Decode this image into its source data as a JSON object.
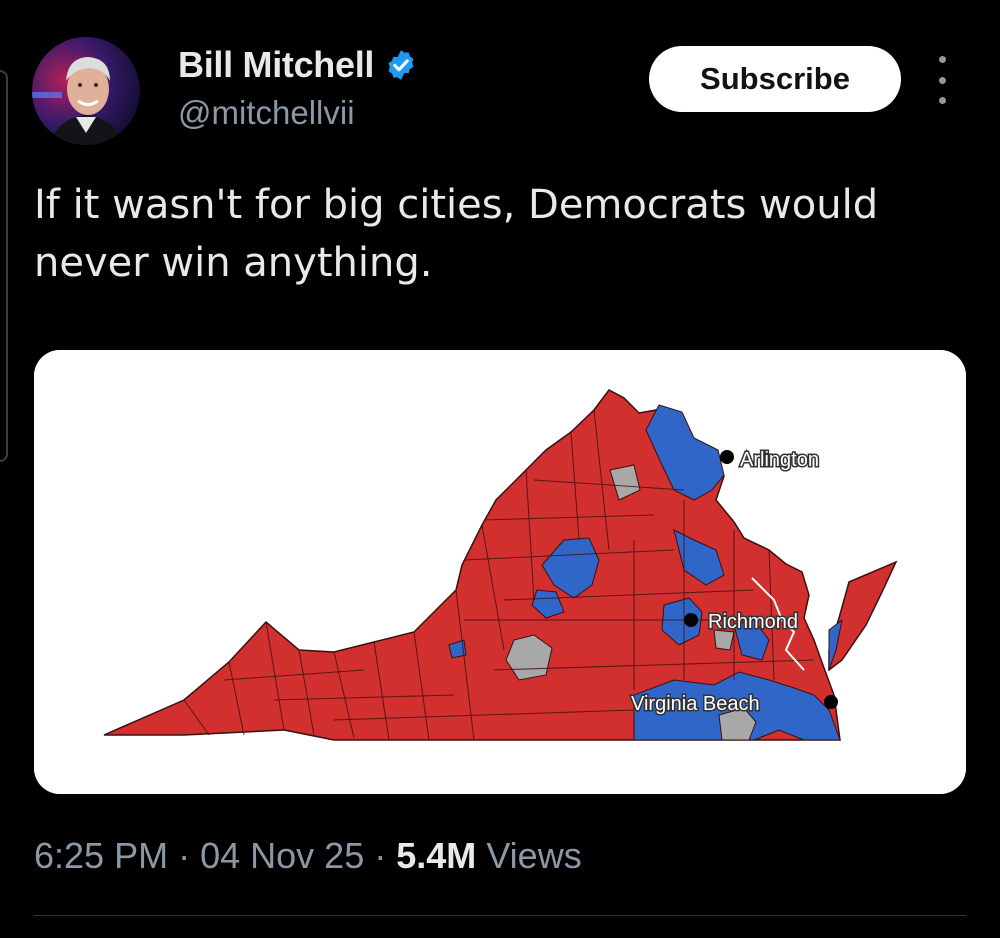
{
  "tweet": {
    "author": {
      "name": "Bill Mitchell",
      "handle": "@mitchellvii",
      "verified": true,
      "verified_color": "#1d9bf0"
    },
    "subscribe_label": "Subscribe",
    "text": "If it wasn't for big cities, Democrats would never win anything.",
    "timestamp": {
      "time": "6:25 PM",
      "date": "04 Nov 25",
      "separator": "·"
    },
    "views": {
      "count": "5.4M",
      "label": "Views"
    }
  },
  "map": {
    "labels": {
      "arlington": "Arlington",
      "richmond": "Richmond",
      "virginia_beach": "Virginia Beach"
    },
    "colors": {
      "republican": "#d22f2f",
      "democrat": "#2f66c8",
      "other": "#a8a8a8",
      "border": "#3a1010"
    }
  },
  "icons": {
    "verified": "verified-badge-icon",
    "more": "more-options-icon"
  }
}
